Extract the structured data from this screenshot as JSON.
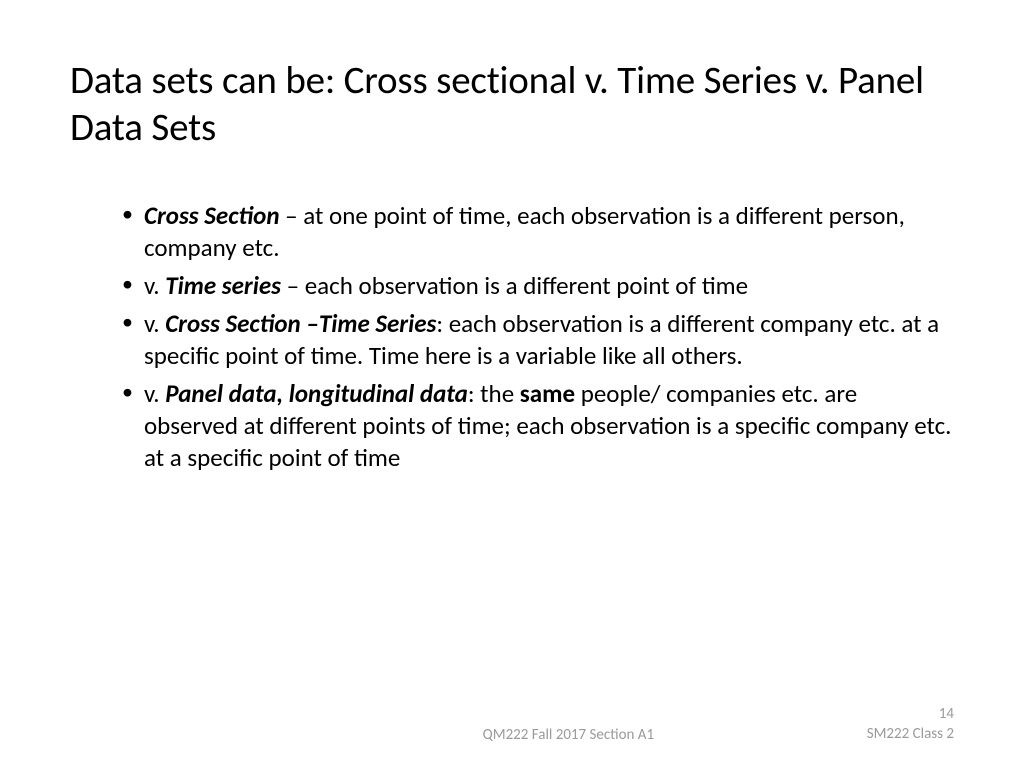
{
  "title": "Data sets can be:  Cross sectional v. Time Series v. Panel Data Sets",
  "bullets": [
    {
      "lead_bold": "Cross Section",
      "lead_sep": " – ",
      "rest": "at one point of time, each observation is a different person, company etc."
    },
    {
      "prefix": "v. ",
      "lead_bold": "Time series",
      "lead_sep": " – ",
      "rest": "each observation is a different point of time"
    },
    {
      "prefix": "v. ",
      "lead_bold": "Cross Section –Time Series",
      "lead_sep": ": ",
      "rest": "each observation is a different company etc. at a specific point of time. Time here is a variable like all others."
    },
    {
      "prefix": "v. ",
      "lead_bold": "Panel data, longitudinal data",
      "lead_sep": ": the ",
      "mid_bold": "same",
      "rest": " people/ companies etc. are observed at different points of time; each observation is a specific  company etc. at a specific point of time"
    }
  ],
  "footer": {
    "left": "QM222 Fall 2017 Section A1",
    "page": "14",
    "right": "SM222 Class 2"
  }
}
